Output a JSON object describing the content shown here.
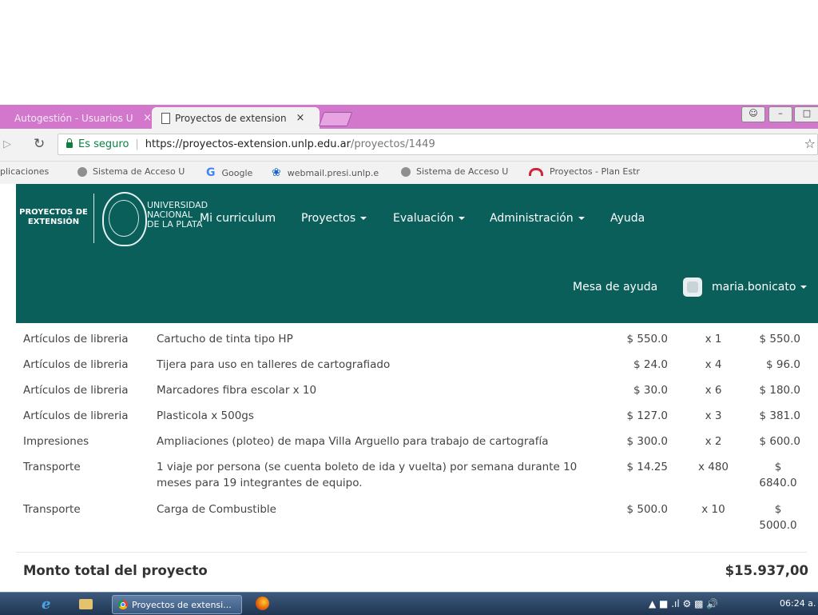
{
  "browser": {
    "tabs": [
      {
        "label": "Autogestión - Usuarios U",
        "active": false,
        "close": "×"
      },
      {
        "label": "Proyectos de extension",
        "active": true,
        "close": "×"
      }
    ],
    "address": {
      "secure_label": "Es seguro",
      "url_main": "https://proyectos-extension.unlp.edu.ar",
      "url_path": "/proyectos/1449"
    },
    "bookmarks": [
      {
        "label": "plicaciones",
        "icon": "apps-icon"
      },
      {
        "label": "Sistema de Acceso U",
        "icon": "siu-icon"
      },
      {
        "label": "Google",
        "icon": "google-icon"
      },
      {
        "label": "webmail.presi.unlp.e",
        "icon": "webmail-icon"
      },
      {
        "label": "Sistema de Acceso U",
        "icon": "siu-icon"
      },
      {
        "label": "Proyectos - Plan Estr",
        "icon": "arc-icon"
      }
    ]
  },
  "site": {
    "brand": {
      "line1": "PROYECTOS DE",
      "line2": "EXTENSIÓN"
    },
    "university": {
      "line1": "UNIVERSIDAD",
      "line2": "NACIONAL",
      "line3": "DE LA PLATA"
    },
    "nav": {
      "mi_curriculum": "Mi curriculum",
      "proyectos": "Proyectos",
      "evaluacion": "Evaluación",
      "administracion": "Administración",
      "ayuda": "Ayuda"
    },
    "help_desk": "Mesa de ayuda",
    "username": "maria.bonicato"
  },
  "table": {
    "rows": [
      {
        "category": "Artículos de libreria",
        "description": "Cartucho de tinta tipo HP",
        "price": "$ 550.0",
        "qty": "x 1",
        "total": "$ 550.0"
      },
      {
        "category": "Artículos de libreria",
        "description": "Tijera para uso en talleres de cartografiado",
        "price": "$ 24.0",
        "qty": "x 4",
        "total": "$ 96.0"
      },
      {
        "category": "Artículos de libreria",
        "description": "Marcadores fibra escolar x 10",
        "price": "$ 30.0",
        "qty": "x 6",
        "total": "$ 180.0"
      },
      {
        "category": "Artículos de libreria",
        "description": "Plasticola x 500gs",
        "price": "$ 127.0",
        "qty": "x 3",
        "total": "$ 381.0"
      },
      {
        "category": "Impresiones",
        "description": "Ampliaciones (ploteo) de mapa Villa Arguello para trabajo de cartografía",
        "price": "$ 300.0",
        "qty": "x 2",
        "total": "$ 600.0"
      },
      {
        "category": "Transporte",
        "description": "1 viaje por persona (se cuenta boleto de ida y vuelta) por semana durante 10 meses para 19 integrantes de equipo.",
        "price": "$ 14.25",
        "qty": "x 480",
        "total": "$ 6840.0"
      },
      {
        "category": "Transporte",
        "description": "Carga de Combustible",
        "price": "$ 500.0",
        "qty": "x 10",
        "total": "$ 5000.0"
      }
    ],
    "total_label": "Monto total del proyecto",
    "total_value": "$15.937,00"
  },
  "taskbar": {
    "task_label": "Proyectos de extensi...",
    "clock": "06:24 a."
  }
}
